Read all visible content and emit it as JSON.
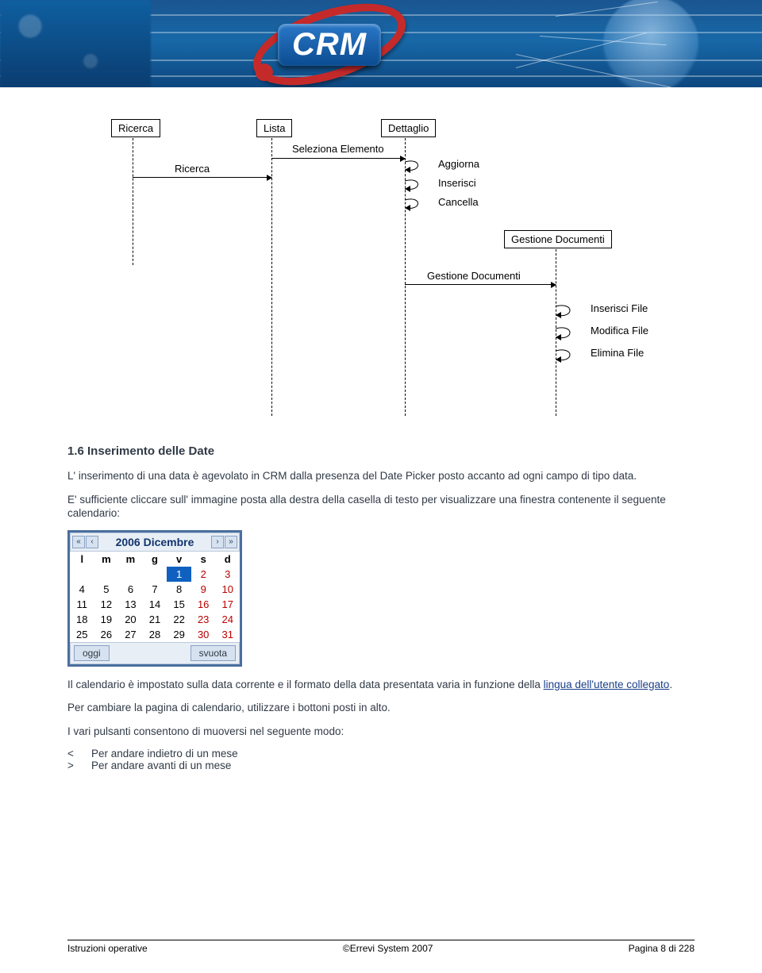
{
  "banner": {
    "logo_text": "CRM"
  },
  "diagram": {
    "boxes": {
      "ricerca": "Ricerca",
      "lista": "Lista",
      "dettaglio": "Dettaglio",
      "gestione_documenti": "Gestione Documenti"
    },
    "messages": {
      "seleziona_elemento": "Seleziona Elemento",
      "ricerca": "Ricerca",
      "aggiorna": "Aggiorna",
      "inserisci": "Inserisci",
      "cancella": "Cancella",
      "gestione_documenti": "Gestione Documenti",
      "inserisci_file": "Inserisci File",
      "modifica_file": "Modifica File",
      "elimina_file": "Elimina File"
    }
  },
  "section": {
    "number_title": "1.6    Inserimento delle Date",
    "intro": "L' inserimento di una data è agevolato in CRM dalla presenza del Date Picker posto accanto ad ogni campo di tipo data.",
    "click_text": "E' sufficiente cliccare sull' immagine posta alla destra della casella di testo per visualizzare una finestra contenente il seguente calendario:",
    "after_calendar_1a": "Il calendario è impostato sulla data corrente e il formato della data presentata varia in funzione della ",
    "link_text": "lingua dell'utente collegato",
    "after_calendar_1b": ".",
    "after_calendar_2": "Per cambiare la pagina di calendario, utilizzare i bottoni posti in alto.",
    "after_calendar_3": "I vari pulsanti consentono di muoversi nel seguente modo:",
    "nav": {
      "back_sym": "<",
      "back_text": "Per andare indietro di un mese",
      "fwd_sym": ">",
      "fwd_text": "Per andare avanti di un mese"
    }
  },
  "calendar": {
    "title": "2006 Dicembre",
    "first_first": "«",
    "prev": "‹",
    "next": "›",
    "last_last": "»",
    "weekdays": [
      "l",
      "m",
      "m",
      "g",
      "v",
      "s",
      "d"
    ],
    "rows": [
      [
        "",
        "",
        "",
        "",
        "1",
        "2",
        "3"
      ],
      [
        "4",
        "5",
        "6",
        "7",
        "8",
        "9",
        "10"
      ],
      [
        "11",
        "12",
        "13",
        "14",
        "15",
        "16",
        "17"
      ],
      [
        "18",
        "19",
        "20",
        "21",
        "22",
        "23",
        "24"
      ],
      [
        "25",
        "26",
        "27",
        "28",
        "29",
        "30",
        "31"
      ]
    ],
    "selected": "1",
    "weekend_cols": [
      5,
      6
    ],
    "today_btn": "oggi",
    "clear_btn": "svuota"
  },
  "footer": {
    "left": "Istruzioni operative",
    "center": "©Errevi System 2007",
    "right": "Pagina 8 di 228"
  }
}
